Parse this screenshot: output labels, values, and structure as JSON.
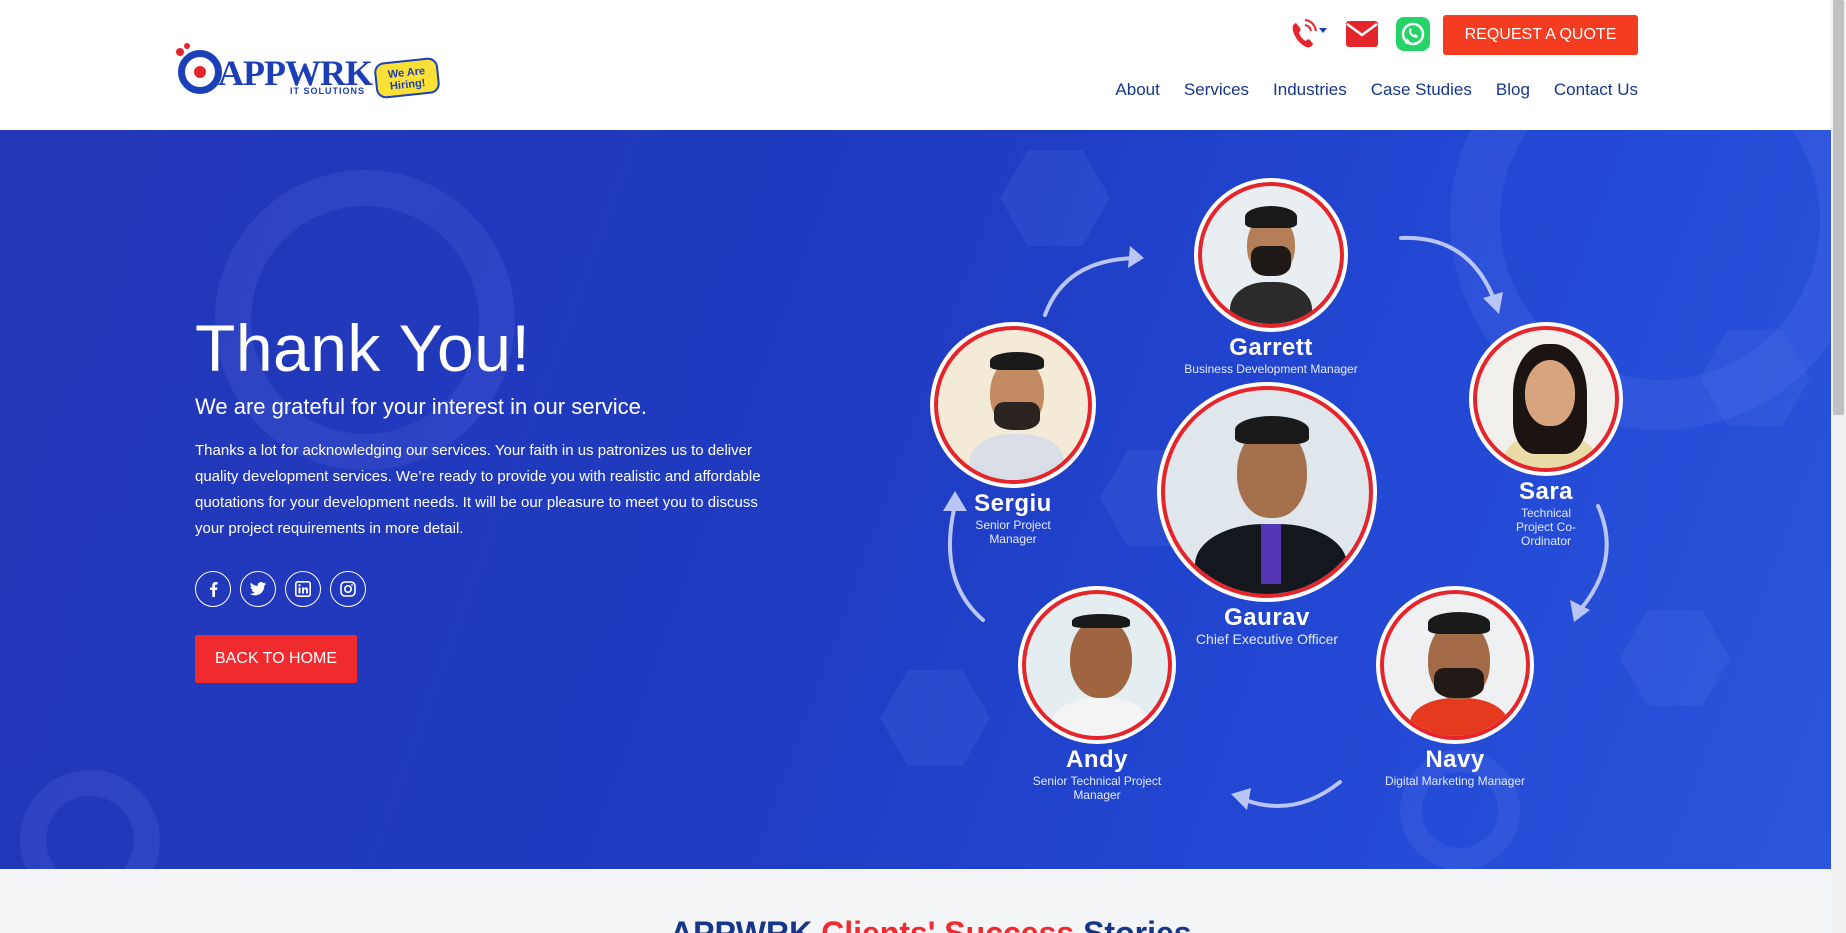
{
  "header": {
    "logo_text": "APPWRK",
    "logo_sub": "IT SOLUTIONS",
    "hiring_badge": "We Are Hiring!",
    "quote_button": "REQUEST A QUOTE",
    "nav": [
      "About",
      "Services",
      "Industries",
      "Case Studies",
      "Blog",
      "Contact Us"
    ],
    "icons": [
      "phone-icon",
      "envelope-icon",
      "whatsapp-icon"
    ]
  },
  "hero": {
    "title": "Thank You!",
    "subtitle": "We are grateful for your interest in our service.",
    "body": "Thanks a lot for acknowledging our services. Your faith in us patronizes us to deliver quality development services. We’re ready to provide you with realistic and affordable quotations for your development needs. It will be our pleasure to meet you to discuss your project requirements in more detail.",
    "socials": [
      "facebook-icon",
      "twitter-icon",
      "linkedin-icon",
      "instagram-icon"
    ],
    "back_button": "BACK TO HOME"
  },
  "team": {
    "garrett": {
      "name": "Garrett",
      "role": "Business Development Manager"
    },
    "sergiu": {
      "name": "Sergiu",
      "role": "Senior Project Manager"
    },
    "gaurav": {
      "name": "Gaurav",
      "role": "Chief Executive Officer"
    },
    "sara": {
      "name": "Sara",
      "role": "Technical Project Co-Ordinator"
    },
    "andy": {
      "name": "Andy",
      "role": "Senior Technical Project Manager"
    },
    "navy": {
      "name": "Navy",
      "role": "Digital Marketing Manager"
    }
  },
  "bottom": {
    "title_part1": "APPWRK",
    "title_part2": "Clients' Success",
    "title_part3": "Stories"
  },
  "colors": {
    "brand_blue": "#1c3fb8",
    "accent_red": "#f12a2e",
    "quote_orange": "#f43c20",
    "hero_bg": "#2338b9"
  }
}
